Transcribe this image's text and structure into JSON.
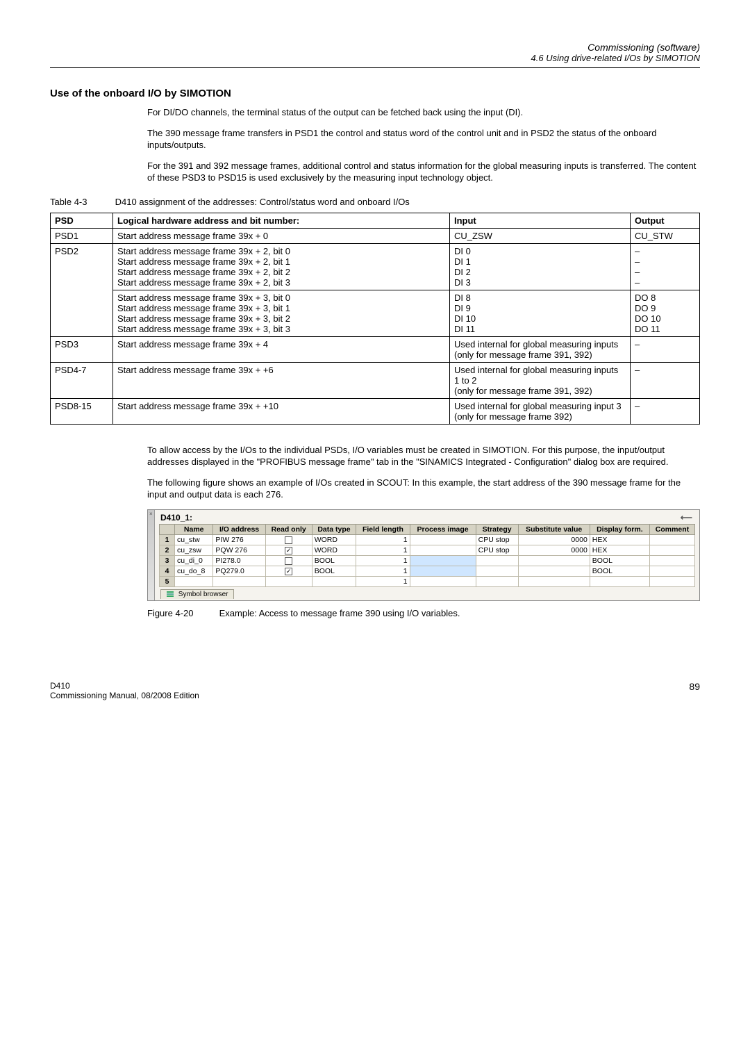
{
  "header": {
    "title": "Commissioning (software)",
    "subtitle": "4.6 Using drive-related I/Os by SIMOTION"
  },
  "section": {
    "heading": "Use of the onboard I/O by SIMOTION",
    "p1": "For DI/DO channels, the terminal status of the output can be fetched back using the input (DI).",
    "p2": "The 390 message frame transfers in PSD1 the control and status word of the control unit and in PSD2 the status of the onboard inputs/outputs.",
    "p3": "For the 391 and 392 message frames, additional control and status information for the global measuring inputs is transferred. The content of these PSD3 to PSD15 is used exclusively by the measuring input technology object."
  },
  "table43": {
    "label": "Table 4-3",
    "caption": "D410 assignment of the addresses: Control/status word and onboard I/Os",
    "headers": {
      "c1": "PSD",
      "c2": "Logical hardware address and bit number:",
      "c3": "Input",
      "c4": "Output"
    },
    "rows": {
      "r1": {
        "psd": "PSD1",
        "addr": "Start address message frame 39x + 0",
        "input": "CU_ZSW",
        "output": "CU_STW"
      },
      "r2a": {
        "psd": "PSD2",
        "addr0": "Start address message frame 39x + 2, bit 0",
        "addr1": "Start address message frame 39x + 2, bit 1",
        "addr2": "Start address message frame 39x + 2, bit 2",
        "addr3": "Start address message frame 39x + 2, bit 3",
        "in0": "DI 0",
        "in1": "DI 1",
        "in2": "DI 2",
        "in3": "DI 3",
        "out0": "–",
        "out1": "–",
        "out2": "–",
        "out3": "–"
      },
      "r2b": {
        "addr0": "Start address message frame 39x + 3, bit 0",
        "addr1": "Start address message frame 39x + 3, bit 1",
        "addr2": "Start address message frame 39x + 3, bit 2",
        "addr3": "Start address message frame 39x + 3, bit 3",
        "in0": "DI 8",
        "in1": "DI 9",
        "in2": "DI 10",
        "in3": "DI 11",
        "out0": "DO 8",
        "out1": "DO 9",
        "out2": "DO 10",
        "out3": "DO 11"
      },
      "r3": {
        "psd": "PSD3",
        "addr": "Start address message frame 39x + 4",
        "in0": "Used internal for global measuring inputs",
        "in1": "(only for message frame 391, 392)",
        "out": "–"
      },
      "r4": {
        "psd": "PSD4-7",
        "addr": "Start address message frame 39x + +6",
        "in0": "Used internal for global measuring inputs 1 to 2",
        "in1": "(only for message frame 391, 392)",
        "out": "–"
      },
      "r5": {
        "psd": "PSD8-15",
        "addr": "Start address message frame 39x + +10",
        "in0": "Used internal for global measuring input 3",
        "in1": "(only for message frame 392)",
        "out": "–"
      }
    }
  },
  "after": {
    "p1": "To allow access by the I/Os to the individual PSDs, I/O variables must be created in SIMOTION. For this purpose, the input/output addresses displayed in the \"PROFIBUS message frame\" tab in the \"SINAMICS Integrated - Configuration\" dialog box are required.",
    "p2": "The following figure shows an example of I/Os created in SCOUT: In this example, the start address of the 390 message frame for the input and output data is each 276."
  },
  "fig": {
    "title": "D410_1:",
    "headers": {
      "c1": "Name",
      "c2": "I/O address",
      "c3": "Read only",
      "c4": "Data type",
      "c5": "Field length",
      "c6": "Process image",
      "c7": "Strategy",
      "c8": "Substitute value",
      "c9": "Display form.",
      "c10": "Comment"
    },
    "rows": [
      {
        "n": "1",
        "name": "cu_stw",
        "io": "PIW 276",
        "ro": false,
        "dt": "WORD",
        "fl": "1",
        "pi": "",
        "st": "CPU stop",
        "sv": "0000",
        "df": "HEX",
        "cm": ""
      },
      {
        "n": "2",
        "name": "cu_zsw",
        "io": "PQW 276",
        "ro": true,
        "dt": "WORD",
        "fl": "1",
        "pi": "",
        "st": "CPU stop",
        "sv": "0000",
        "df": "HEX",
        "cm": ""
      },
      {
        "n": "3",
        "name": "cu_di_0",
        "io": "PI278.0",
        "ro": false,
        "dt": "BOOL",
        "fl": "1",
        "pi": "",
        "st": "",
        "sv": "",
        "df": "BOOL",
        "cm": ""
      },
      {
        "n": "4",
        "name": "cu_do_8",
        "io": "PQ279.0",
        "ro": true,
        "dt": "BOOL",
        "fl": "1",
        "pi": "",
        "st": "",
        "sv": "",
        "df": "BOOL",
        "cm": ""
      },
      {
        "n": "5",
        "name": "",
        "io": "",
        "ro": null,
        "dt": "",
        "fl": "1",
        "pi": "",
        "st": "",
        "sv": "",
        "df": "",
        "cm": ""
      }
    ],
    "tab": "Symbol browser",
    "caption_label": "Figure 4-20",
    "caption_text": "Example: Access to message frame 390 using I/O variables."
  },
  "footer": {
    "left1": "D410",
    "left2": "Commissioning Manual, 08/2008 Edition",
    "page": "89"
  }
}
